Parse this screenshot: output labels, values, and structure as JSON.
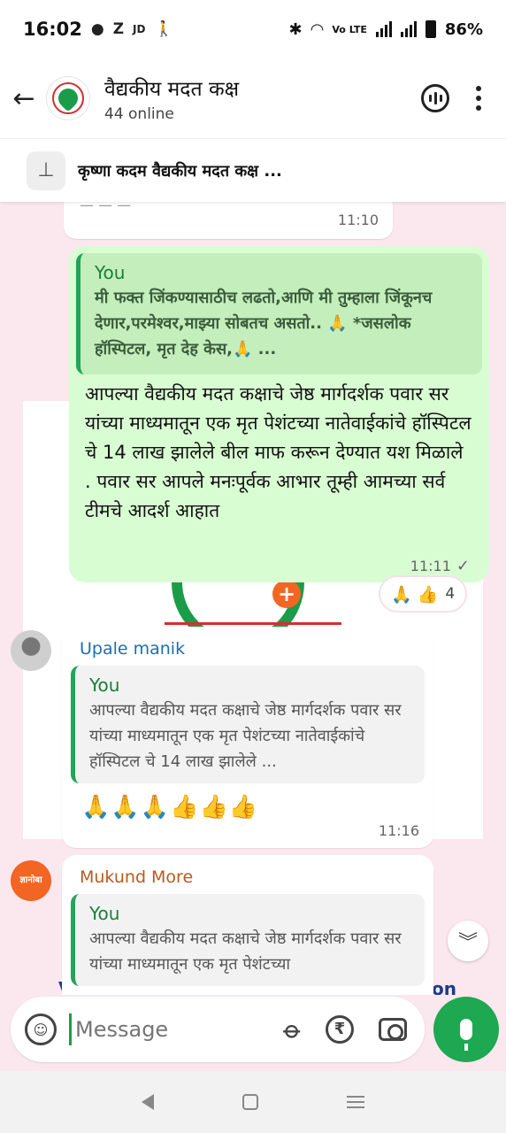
{
  "status_bar": {
    "time": "16:02",
    "apps": [
      "Z",
      "JD"
    ],
    "network": "Vo LTE",
    "battery": "86%"
  },
  "header": {
    "group_name": "वैद्यकीय मदत कक्ष",
    "online": "44 online"
  },
  "pinned": {
    "text": "कृष्णा कदम वैद्यकीय मदत कक्ष ..."
  },
  "messages": {
    "previous": {
      "time": "11:10"
    },
    "outgoing": {
      "quote_name": "You",
      "quote_text": "मी फक्त जिंकण्यासाठीच लढतो,आणि मी तुम्हाला जिंकूनच देणार,परमेश्वर,माझ्या सोबतच असतो.. 🙏 *जसलोक हॉस्पिटल, मृत देह केस,🙏 ...",
      "text": "आपल्या वैद्यकीय मदत कक्षाचे जेष्ठ मार्गदर्शक पवार सर यांच्या माध्यमातून एक मृत पेशंटच्या नातेवाईकांचे हॉस्पिटल चे 14 लाख झालेले बील माफ करून देण्यात यश मिळाले . पवार सर आपले मनःपूर्वक आभार तूम्ही आमच्या सर्व टीमचे आदर्श आहात",
      "time": "11:11",
      "reactions": "🙏 👍",
      "reaction_count": "4"
    },
    "incoming1": {
      "sender": "Upale manik",
      "quote_name": "You",
      "quote_text": "आपल्या वैद्यकीय मदत कक्षाचे जेष्ठ मार्गदर्शक पवार सर यांच्या माध्यमातून एक मृत पेशंटच्या नातेवाईकांचे हॉस्पिटल चे 14 लाख झालेले ...",
      "text": "🙏🙏🙏👍👍👍",
      "time": "11:16"
    },
    "incoming2": {
      "sender": "Mukund More",
      "quote_name": "You",
      "quote_text": "आपल्या वैद्यकीय मदत कक्षाचे जेष्ठ मार्गदर्शक पवार सर यांच्या माध्यमातून एक मृत पेशंटच्या",
      "avatar_text": "ज्ञानोबा"
    }
  },
  "wallpaper": {
    "word_right": "on",
    "word_left": "V"
  },
  "composer": {
    "placeholder": "Message"
  },
  "icons": [
    "back-arrow-icon",
    "voice-chat-icon",
    "more-options-icon",
    "pin-icon",
    "emoji-icon",
    "attach-icon",
    "rupee-icon",
    "camera-icon",
    "mic-icon",
    "scroll-down-icon"
  ]
}
